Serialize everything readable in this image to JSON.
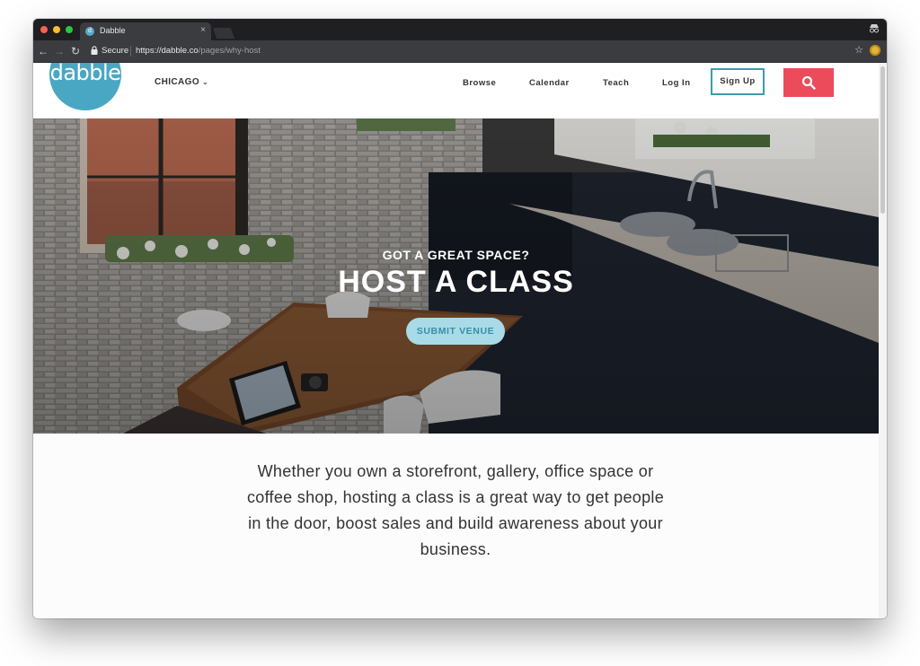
{
  "browser": {
    "tab_title": "Dabble",
    "tab_close": "×",
    "secure_label": "Secure",
    "url_host": "https://dabble.co",
    "url_path": "/pages/why-host"
  },
  "site": {
    "logo_text": "dabble",
    "city": "CHICAGO",
    "nav": {
      "browse": "Browse",
      "calendar": "Calendar",
      "teach": "Teach",
      "login": "Log In",
      "signup": "Sign Up"
    }
  },
  "hero": {
    "eyebrow": "GOT A GREAT SPACE?",
    "title": "HOST A CLASS",
    "button": "SUBMIT VENUE"
  },
  "intro": {
    "text": "Whether you own a storefront, gallery, office space or coffee shop, hosting a class is a great way to get people in the door, boost sales and build awareness about your business."
  },
  "colors": {
    "brand": "#4aa7c3",
    "signup_border": "#3d9cab",
    "search_button": "#eb4b5b",
    "submit_button": "#a8dbe7"
  },
  "icons": {
    "lock": "lock-icon",
    "search": "search-icon",
    "star": "star-icon",
    "chevron": "chevron-down-icon"
  }
}
